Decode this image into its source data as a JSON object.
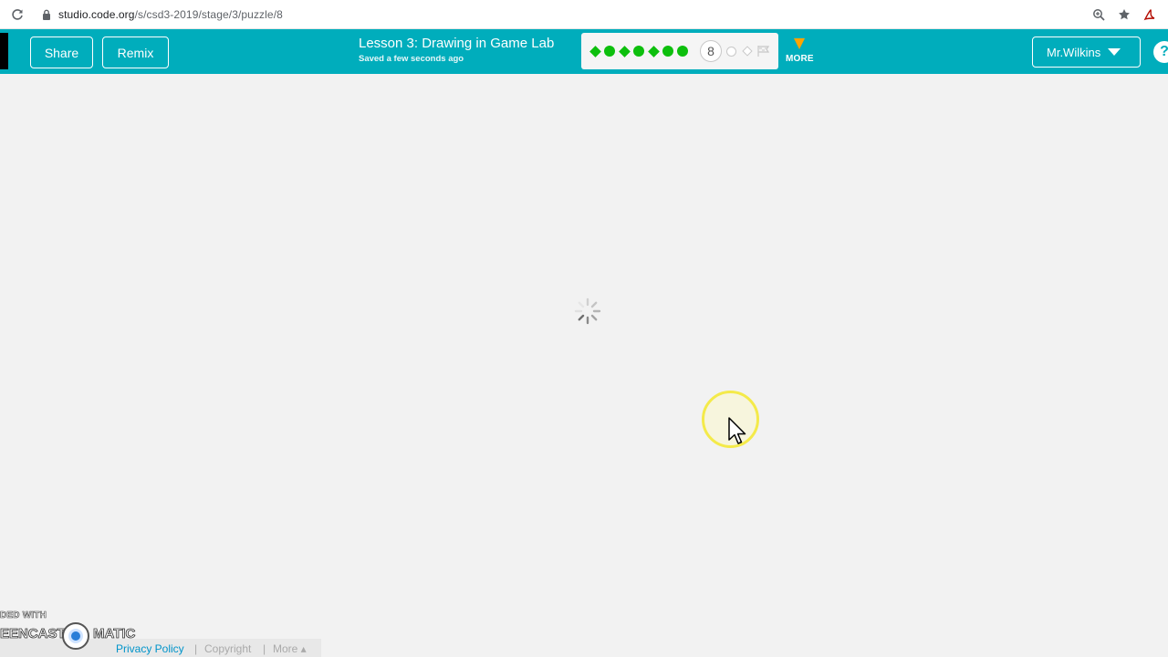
{
  "browser": {
    "url_host": "studio.code.org",
    "url_path": "/s/csd3-2019/stage/3/puzzle/8"
  },
  "header": {
    "share_label": "Share",
    "remix_label": "Remix",
    "lesson_title": "Lesson 3: Drawing in Game Lab",
    "save_status": "Saved a few seconds ago",
    "progress": {
      "completed": [
        "diamond",
        "circle",
        "diamond",
        "circle",
        "diamond",
        "circle",
        "circle"
      ],
      "current_level": "8",
      "remaining": [
        "circle",
        "diamond",
        "flag"
      ]
    },
    "more_label": "MORE",
    "user_label": "Mr.Wilkins",
    "help_label": "?"
  },
  "colors": {
    "nav_bg": "#00adbc",
    "complete": "#0dbf0d",
    "more_arrow": "#ffa400",
    "link": "#0094ca"
  },
  "footer": {
    "privacy": "Privacy Policy",
    "separator": "|",
    "copyright": "Copyright",
    "more": "More ▴"
  },
  "watermark": {
    "top_text": "DED WITH",
    "left_text": "EENCAST",
    "right_text": "MATIC"
  }
}
